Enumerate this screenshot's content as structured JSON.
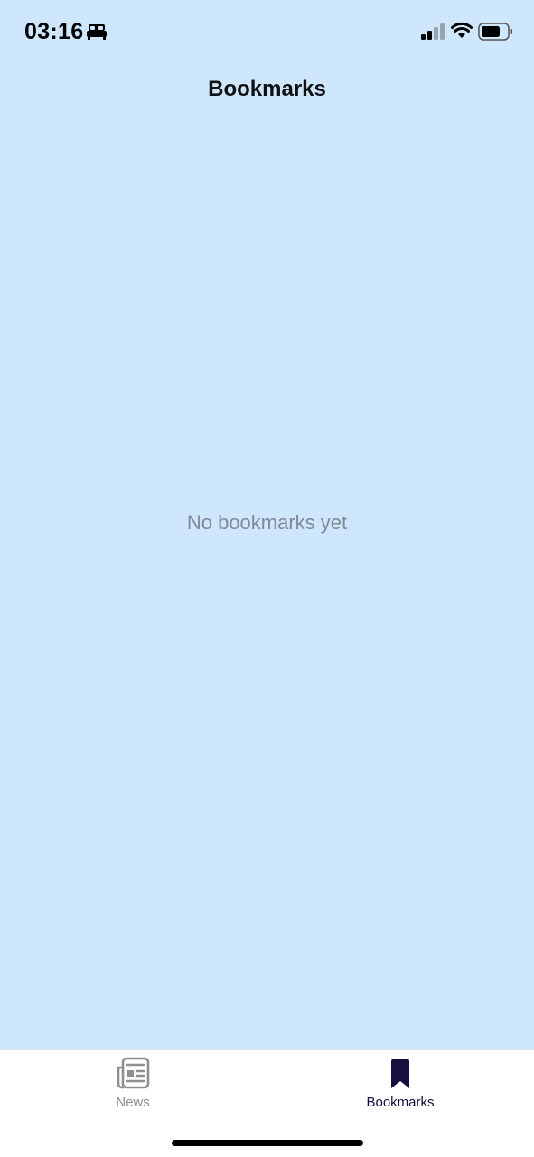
{
  "status_bar": {
    "time": "03:16",
    "focus_icon": "bed-icon",
    "signal_icon": "cellular-signal-icon",
    "wifi_icon": "wifi-icon",
    "battery_icon": "battery-icon"
  },
  "header": {
    "title": "Bookmarks"
  },
  "main": {
    "empty_message": "No bookmarks yet",
    "background_color": "#cfe7fd"
  },
  "tab_bar": {
    "tabs": [
      {
        "label": "News",
        "icon": "newspaper-icon",
        "active": false
      },
      {
        "label": "Bookmarks",
        "icon": "bookmark-icon",
        "active": true
      }
    ],
    "active_color": "#141040",
    "inactive_color": "#8e8e93"
  }
}
